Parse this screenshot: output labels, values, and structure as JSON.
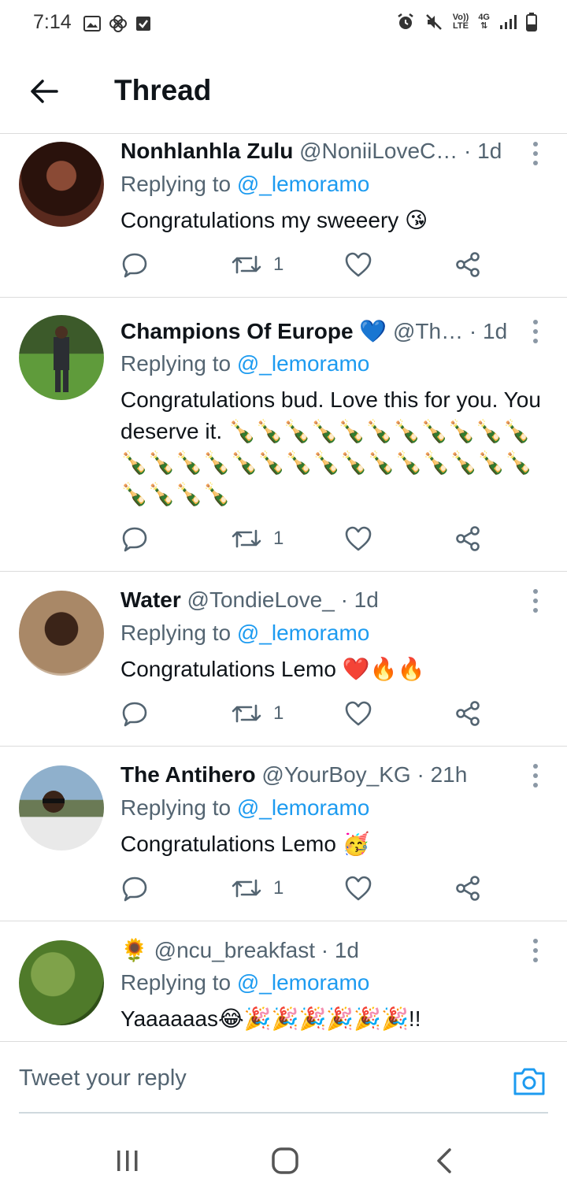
{
  "status_bar": {
    "time": "7:14",
    "volte": "Vo))",
    "lte": "LTE",
    "network": "4G"
  },
  "header": {
    "title": "Thread"
  },
  "tweets": [
    {
      "name": "Nonhlanhla Zulu",
      "handle": "@NoniiLoveC…",
      "time": "· 1d",
      "replying_label": "Replying to",
      "mention": "@_lemoramo",
      "text": "Congratulations my sweeery 😘",
      "retweets": "1",
      "avatar_color": "#5a2a1e"
    },
    {
      "name": "Champions Of Europe 💙",
      "handle": "@Th…",
      "time": "· 1d",
      "replying_label": "Replying to",
      "mention": "@_lemoramo",
      "text": "Congratulations bud. Love this for you. You deserve it. 🍾🍾🍾🍾🍾🍾🍾🍾🍾🍾🍾🍾🍾🍾🍾🍾🍾🍾🍾🍾🍾🍾🍾🍾🍾🍾🍾🍾🍾🍾",
      "retweets": "1",
      "avatar_color": "#4b7a35"
    },
    {
      "name": "Water",
      "handle": "@TondieLove_",
      "time": "· 1d",
      "replying_label": "Replying to",
      "mention": "@_lemoramo",
      "text": "Congratulations Lemo ❤️🔥🔥",
      "retweets": "1",
      "avatar_color": "#a98867"
    },
    {
      "name": "The Antihero",
      "handle": "@YourBoy_KG",
      "time": "· 21h",
      "replying_label": "Replying to",
      "mention": "@_lemoramo",
      "text": "Congratulations Lemo 🥳",
      "retweets": "1",
      "avatar_color": "#6c8aa3"
    },
    {
      "name": "🌻",
      "handle": "@ncu_breakfast",
      "time": "· 1d",
      "replying_label": "Replying to",
      "mention": "@_lemoramo",
      "text": "Yaaaaaas😂🎉🎉🎉🎉🎉🎉!!",
      "retweets": "",
      "avatar_color": "#4f7a2a"
    }
  ],
  "composer": {
    "placeholder": "Tweet your reply"
  },
  "colors": {
    "accent": "#1d9bf0",
    "secondary_text": "#536471",
    "divider": "#dcdcdc"
  },
  "icons": [
    "back-arrow-icon",
    "reply-icon",
    "retweet-icon",
    "like-icon",
    "share-icon",
    "more-icon",
    "camera-icon",
    "recents-icon",
    "home-icon",
    "nav-back-icon"
  ]
}
